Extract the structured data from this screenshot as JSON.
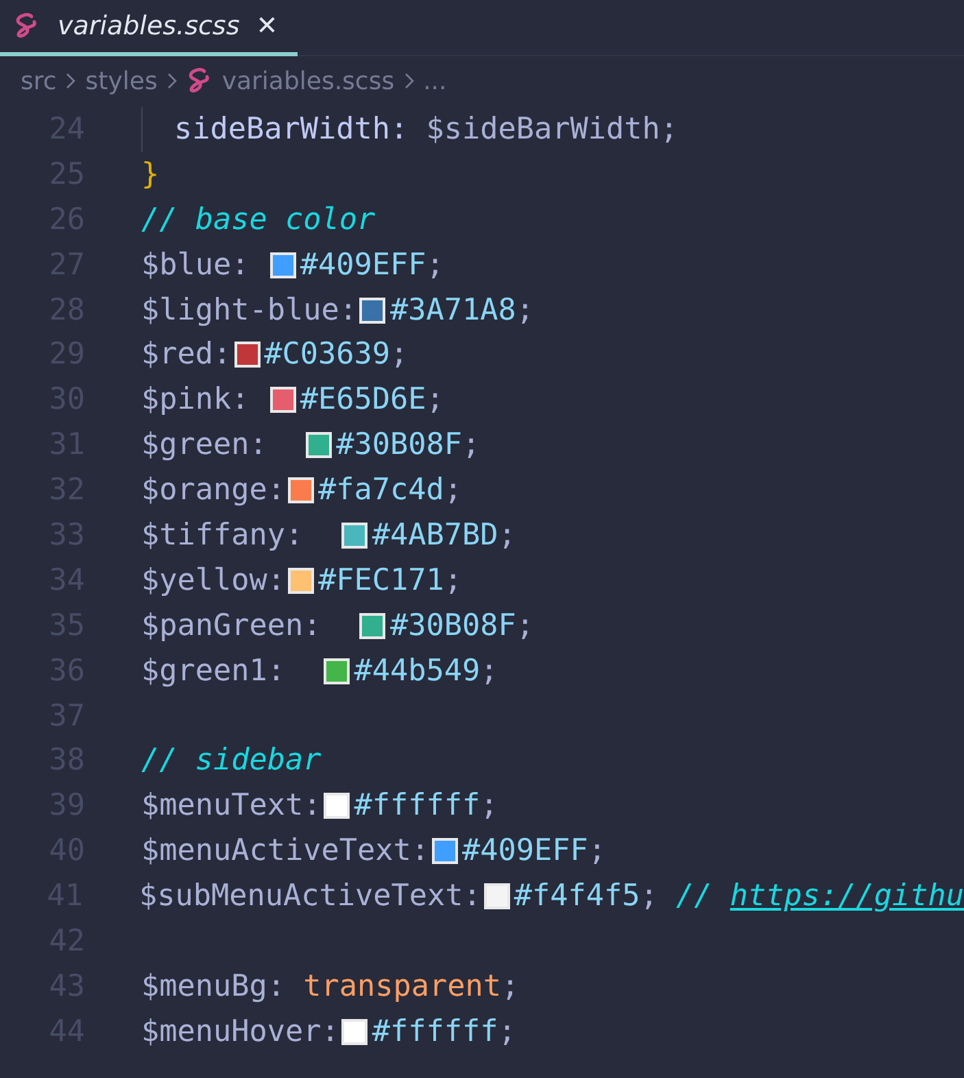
{
  "tabs": [
    {
      "label": "variables.scss",
      "selected": true,
      "close": "✕"
    }
  ],
  "breadcrumb": [
    {
      "text": "src",
      "kind": "folder"
    },
    {
      "text": "styles",
      "kind": "folder"
    },
    {
      "text": "variables.scss",
      "kind": "file"
    },
    {
      "text": "...",
      "kind": "more"
    }
  ],
  "lines": [
    {
      "number": "24",
      "indented": true,
      "tokens": [
        {
          "kind": "prop",
          "text": "sideBarWidth: "
        },
        {
          "kind": "var",
          "text": "$sideBarWidth"
        },
        {
          "kind": "punct",
          "text": ";"
        }
      ]
    },
    {
      "number": "25",
      "indented": false,
      "tokens": [
        {
          "kind": "brace",
          "text": "}"
        }
      ]
    },
    {
      "number": "26",
      "indented": false,
      "tokens": [
        {
          "kind": "comment",
          "text": "// base color"
        }
      ]
    },
    {
      "number": "27",
      "indented": false,
      "tokens": [
        {
          "kind": "var",
          "text": "$blue: "
        },
        {
          "kind": "swatch",
          "color": "#409eff"
        },
        {
          "kind": "hex",
          "text": "#409EFF"
        },
        {
          "kind": "punct",
          "text": ";"
        }
      ]
    },
    {
      "number": "28",
      "indented": false,
      "tokens": [
        {
          "kind": "var",
          "text": "$light-blue:"
        },
        {
          "kind": "swatch",
          "color": "#3a71a8"
        },
        {
          "kind": "hex",
          "text": "#3A71A8"
        },
        {
          "kind": "punct",
          "text": ";"
        }
      ]
    },
    {
      "number": "29",
      "indented": false,
      "tokens": [
        {
          "kind": "var",
          "text": "$red:"
        },
        {
          "kind": "swatch",
          "color": "#c03639"
        },
        {
          "kind": "hex",
          "text": "#C03639"
        },
        {
          "kind": "punct",
          "text": ";"
        }
      ]
    },
    {
      "number": "30",
      "indented": false,
      "tokens": [
        {
          "kind": "var",
          "text": "$pink: "
        },
        {
          "kind": "swatch",
          "color": "#e65d6e"
        },
        {
          "kind": "hex",
          "text": "#E65D6E"
        },
        {
          "kind": "punct",
          "text": ";"
        }
      ]
    },
    {
      "number": "31",
      "indented": false,
      "tokens": [
        {
          "kind": "var",
          "text": "$green:  "
        },
        {
          "kind": "swatch",
          "color": "#30b08f"
        },
        {
          "kind": "hex",
          "text": "#30B08F"
        },
        {
          "kind": "punct",
          "text": ";"
        }
      ]
    },
    {
      "number": "32",
      "indented": false,
      "tokens": [
        {
          "kind": "var",
          "text": "$orange:"
        },
        {
          "kind": "swatch",
          "color": "#fa7c4d"
        },
        {
          "kind": "hex",
          "text": "#fa7c4d"
        },
        {
          "kind": "punct",
          "text": ";"
        }
      ]
    },
    {
      "number": "33",
      "indented": false,
      "tokens": [
        {
          "kind": "var",
          "text": "$tiffany:  "
        },
        {
          "kind": "swatch",
          "color": "#4ab7bd"
        },
        {
          "kind": "hex",
          "text": "#4AB7BD"
        },
        {
          "kind": "punct",
          "text": ";"
        }
      ]
    },
    {
      "number": "34",
      "indented": false,
      "tokens": [
        {
          "kind": "var",
          "text": "$yellow:"
        },
        {
          "kind": "swatch",
          "color": "#fec171"
        },
        {
          "kind": "hex",
          "text": "#FEC171"
        },
        {
          "kind": "punct",
          "text": ";"
        }
      ]
    },
    {
      "number": "35",
      "indented": false,
      "tokens": [
        {
          "kind": "var",
          "text": "$panGreen:  "
        },
        {
          "kind": "swatch",
          "color": "#30b08f"
        },
        {
          "kind": "hex",
          "text": "#30B08F"
        },
        {
          "kind": "punct",
          "text": ";"
        }
      ]
    },
    {
      "number": "36",
      "indented": false,
      "tokens": [
        {
          "kind": "var",
          "text": "$green1:  "
        },
        {
          "kind": "swatch",
          "color": "#44b549"
        },
        {
          "kind": "hex",
          "text": "#44b549"
        },
        {
          "kind": "punct",
          "text": ";"
        }
      ]
    },
    {
      "number": "37",
      "indented": false
    },
    {
      "number": "38",
      "indented": false,
      "tokens": [
        {
          "kind": "comment",
          "text": "// sidebar"
        }
      ]
    },
    {
      "number": "39",
      "indented": false,
      "tokens": [
        {
          "kind": "var",
          "text": "$menuText:"
        },
        {
          "kind": "swatch",
          "color": "#ffffff"
        },
        {
          "kind": "hex",
          "text": "#ffffff"
        },
        {
          "kind": "punct",
          "text": ";"
        }
      ]
    },
    {
      "number": "40",
      "indented": false,
      "tokens": [
        {
          "kind": "var",
          "text": "$menuActiveText:"
        },
        {
          "kind": "swatch",
          "color": "#409eff"
        },
        {
          "kind": "hex",
          "text": "#409EFF"
        },
        {
          "kind": "punct",
          "text": ";"
        }
      ]
    },
    {
      "number": "41",
      "indented": false,
      "tokens": [
        {
          "kind": "var",
          "text": "$subMenuActiveText:"
        },
        {
          "kind": "swatch",
          "color": "#f4f4f5"
        },
        {
          "kind": "hex",
          "text": "#f4f4f5"
        },
        {
          "kind": "punct",
          "text": "; "
        },
        {
          "kind": "comment",
          "text": "// "
        },
        {
          "kind": "link",
          "text": "https://githu"
        }
      ]
    },
    {
      "number": "42",
      "indented": false
    },
    {
      "number": "43",
      "indented": false,
      "tokens": [
        {
          "kind": "var",
          "text": "$menuBg: "
        },
        {
          "kind": "keyword",
          "text": "transparent"
        },
        {
          "kind": "punct",
          "text": ";"
        }
      ]
    },
    {
      "number": "44",
      "indented": false,
      "tokens": [
        {
          "kind": "var",
          "text": "$menuHover:"
        },
        {
          "kind": "swatch",
          "color": "#ffffff"
        },
        {
          "kind": "hex",
          "text": "#ffffff"
        },
        {
          "kind": "punct",
          "text": ";"
        }
      ]
    }
  ]
}
